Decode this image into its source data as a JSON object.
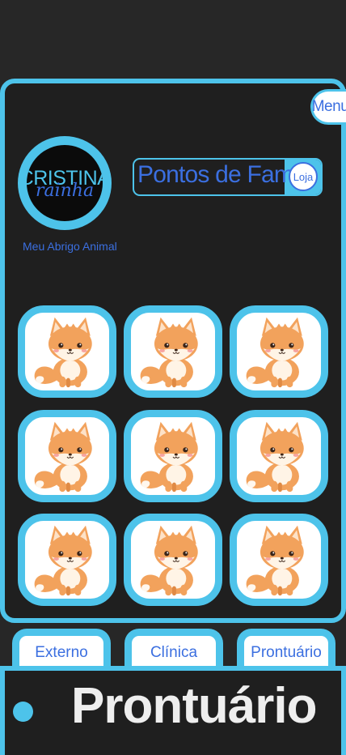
{
  "menu": {
    "label": "Menu"
  },
  "profile": {
    "avatar_line1": "CRISTINA",
    "avatar_line2": "rainha",
    "shelter_name": "Meu Abrigo Animal"
  },
  "fame": {
    "label": "Pontos de Fama",
    "shop_label": "Loja"
  },
  "animals": [
    {
      "name": "fox"
    },
    {
      "name": "fox"
    },
    {
      "name": "fox"
    },
    {
      "name": "fox"
    },
    {
      "name": "fox"
    },
    {
      "name": "fox"
    },
    {
      "name": "fox"
    },
    {
      "name": "fox"
    },
    {
      "name": "fox"
    }
  ],
  "tabs": [
    {
      "label": "Externo"
    },
    {
      "label": "Clínica"
    },
    {
      "label": "Prontuário"
    }
  ],
  "section": {
    "title": "Prontuário"
  },
  "colors": {
    "accent": "#4dc3ea",
    "text_blue": "#3b6fe0",
    "background": "#272727",
    "panel": "#1f1f1f"
  }
}
